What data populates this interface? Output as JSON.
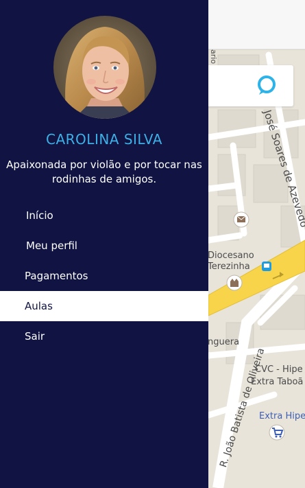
{
  "profile": {
    "name": "CAROLINA SILVA",
    "bio": "Apaixonada por violão e por tocar nas rodinhas de amigos."
  },
  "menu": {
    "items": [
      {
        "label": "Início",
        "indent": 38,
        "active": false
      },
      {
        "label": "Meu perfil",
        "indent": 38,
        "active": false
      },
      {
        "label": "Pagamentos",
        "indent": 36,
        "active": false
      },
      {
        "label": "Aulas",
        "indent": 36,
        "active": true
      },
      {
        "label": "Sair",
        "indent": 36,
        "active": false
      }
    ]
  },
  "map": {
    "labels": {
      "street_jose": "José Soares de Azevedo",
      "diocesano": "Diocesano",
      "terezinha": "Terezinha",
      "nguera": "nguera",
      "street_joao": "R. João Batista de Oliveira",
      "cvc": "CVC - Hipe",
      "extra_taboao": "Extra Taboã",
      "extra_hipe": "Extra Hipe",
      "top_edge": "ario"
    }
  },
  "colors": {
    "drawer_bg": "#111442",
    "accent": "#3fb0e6",
    "chat_icon": "#2eb3e8"
  }
}
